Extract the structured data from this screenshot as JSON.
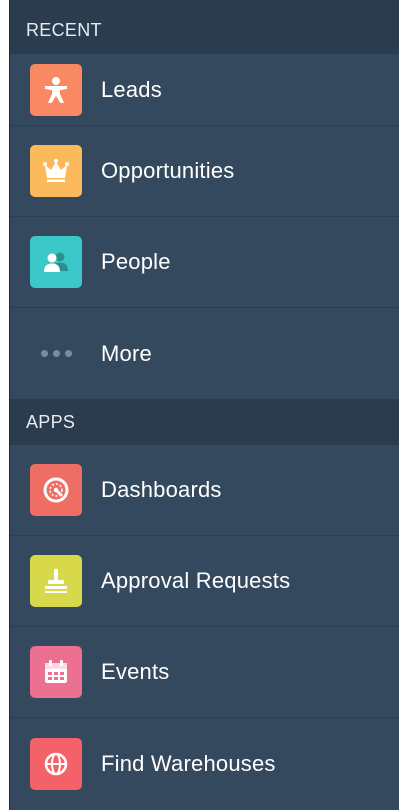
{
  "recent": {
    "header": "RECENT",
    "items": [
      {
        "label": "Leads",
        "icon": "person-icon",
        "color": "#f88962"
      },
      {
        "label": "Opportunities",
        "icon": "crown-icon",
        "color": "#fcb95b"
      },
      {
        "label": "People",
        "icon": "people-icon",
        "color": "#3cc8c8"
      },
      {
        "label": "More",
        "icon": "more-dots-icon"
      }
    ]
  },
  "apps": {
    "header": "APPS",
    "items": [
      {
        "label": "Dashboards",
        "icon": "gauge-icon",
        "color": "#ef6e64"
      },
      {
        "label": "Approval Requests",
        "icon": "stamp-icon",
        "color": "#d7d84a"
      },
      {
        "label": "Events",
        "icon": "calendar-icon",
        "color": "#eb7092"
      },
      {
        "label": "Find Warehouses",
        "icon": "globe-icon",
        "color": "#f36169"
      }
    ]
  }
}
